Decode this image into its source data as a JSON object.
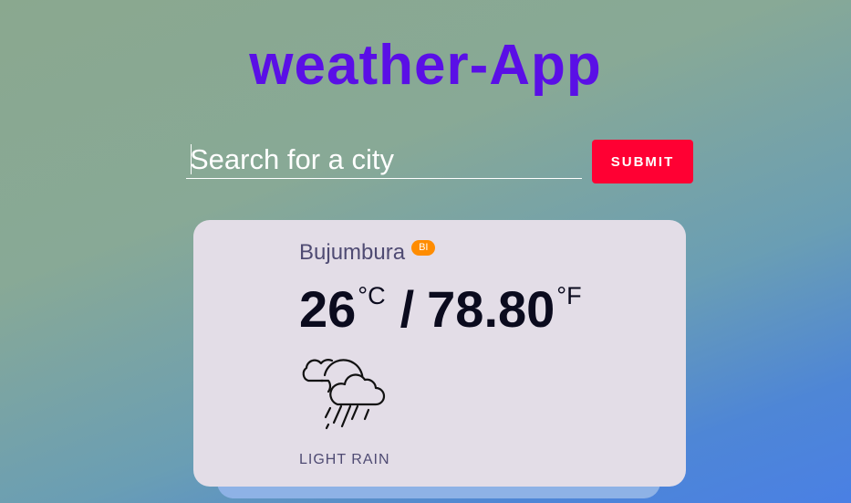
{
  "app": {
    "title": "weather-App"
  },
  "search": {
    "placeholder": "Search for a city",
    "value": "",
    "submit_label": "SUBMIT"
  },
  "weather": {
    "city": "Bujumbura",
    "country_code": "BI",
    "temp_c": "26",
    "unit_c": "°C",
    "separator": "/",
    "temp_f": "78.80",
    "unit_f": "°F",
    "icon": "cloud-sun-rain-icon",
    "description": "LIGHT RAIN"
  },
  "colors": {
    "title": "#5a0fe6",
    "submit": "#ff0033",
    "badge": "#ff8c00",
    "card": "#e3dde7"
  }
}
